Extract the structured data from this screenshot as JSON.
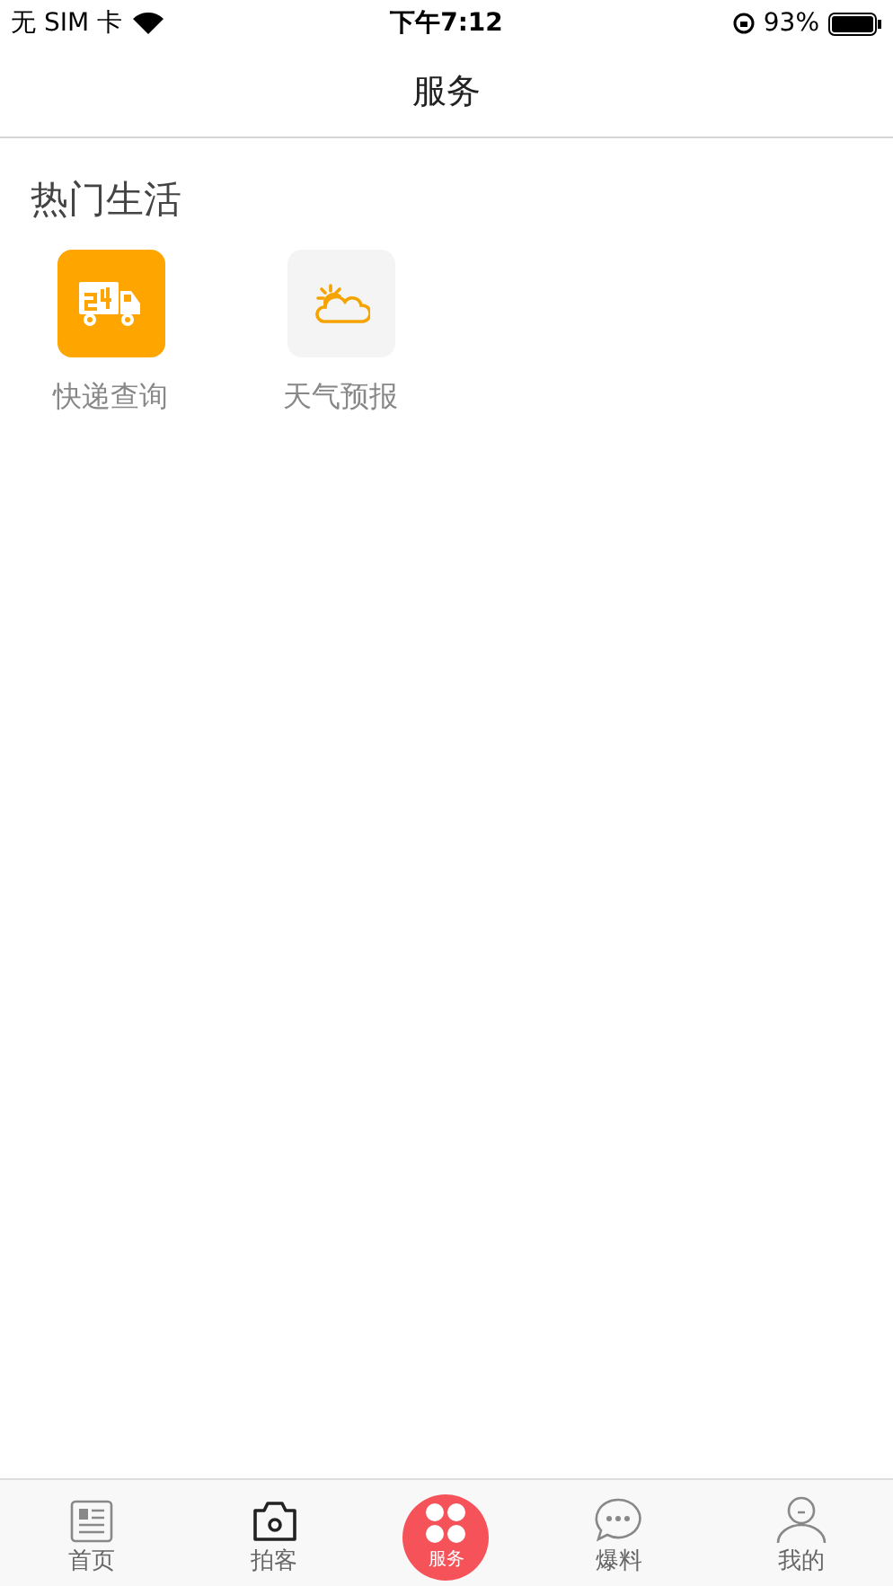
{
  "status_bar": {
    "carrier": "无 SIM 卡",
    "time": "下午7:12",
    "battery": "93%"
  },
  "nav_bar": {
    "title": "服务"
  },
  "section": {
    "title": "热门生活",
    "items": [
      {
        "label": "快递查询",
        "kind": "truck"
      },
      {
        "label": "天气预报",
        "kind": "weather"
      }
    ]
  },
  "tab_bar": [
    {
      "label": "首页",
      "kind": "news",
      "selected": false
    },
    {
      "label": "拍客",
      "kind": "camera",
      "selected": false
    },
    {
      "label": "服务",
      "kind": "service",
      "selected": true
    },
    {
      "label": "爆料",
      "kind": "chat",
      "selected": false
    },
    {
      "label": "我的",
      "kind": "person",
      "selected": false
    }
  ]
}
